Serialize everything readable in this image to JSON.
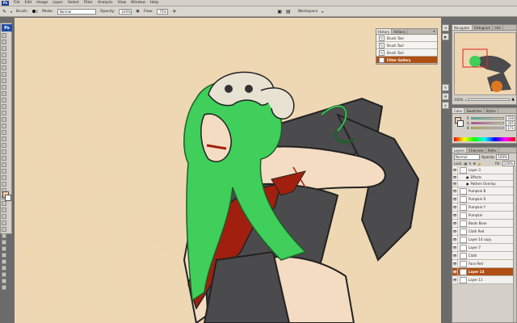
{
  "menu": {
    "app_icon": "Ps",
    "items": [
      "File",
      "Edit",
      "Image",
      "Layer",
      "Select",
      "Filter",
      "Analysis",
      "View",
      "Window",
      "Help"
    ]
  },
  "options": {
    "brush_label": "Brush:",
    "brush_size": "1",
    "mode_label": "Mode:",
    "mode_value": "Normal",
    "opacity_label": "Opacity:",
    "opacity_value": "100%",
    "flow_label": "Flow:",
    "flow_value": "75%",
    "workspace_label": "Workspace"
  },
  "toolbox": {
    "logo": "Ps"
  },
  "history": {
    "tabs": [
      "History",
      "Actions"
    ],
    "items": [
      {
        "label": "Brush Tool",
        "selected": false
      },
      {
        "label": "Brush Tool",
        "selected": false
      },
      {
        "label": "Brush Tool",
        "selected": false
      },
      {
        "label": "Filter Gallery",
        "selected": true
      }
    ]
  },
  "navigator": {
    "tabs": [
      "Navigator",
      "Histogram",
      "Info"
    ],
    "zoom": "100%"
  },
  "color": {
    "tabs": [
      "Color",
      "Swatches",
      "Styles"
    ],
    "r_label": "R",
    "g_label": "G",
    "b_label": "B",
    "r": "236",
    "g": "205",
    "b": "171",
    "fg": "#eccdab"
  },
  "layers": {
    "tabs": [
      "Layers",
      "Channels",
      "Paths"
    ],
    "blend": "Normal",
    "opacity_label": "Opacity:",
    "opacity": "100%",
    "lock_label": "Lock:",
    "fill_label": "Fill:",
    "fill": "100%",
    "items": [
      {
        "name": "Layer 3",
        "kind": "layer",
        "selected": false
      },
      {
        "name": "Effects",
        "kind": "fx",
        "selected": false
      },
      {
        "name": "Pattern Overlay",
        "kind": "fx",
        "selected": false
      },
      {
        "name": "Pumpkin B",
        "kind": "layer",
        "selected": false
      },
      {
        "name": "Pumpkin R",
        "kind": "layer",
        "selected": false
      },
      {
        "name": "Pumpkin Y",
        "kind": "layer",
        "selected": false
      },
      {
        "name": "Pumpkin",
        "kind": "layer",
        "selected": false
      },
      {
        "name": "Boots Base",
        "kind": "layer",
        "selected": false
      },
      {
        "name": "Cloth Red",
        "kind": "layer",
        "selected": false
      },
      {
        "name": "Layer 14 copy",
        "kind": "layer",
        "selected": false
      },
      {
        "name": "Layer 7",
        "kind": "layer",
        "selected": false
      },
      {
        "name": "Cloth",
        "kind": "layer",
        "selected": false
      },
      {
        "name": "Face Red",
        "kind": "layer",
        "selected": false
      },
      {
        "name": "Layer 14",
        "kind": "layer",
        "selected": true
      },
      {
        "name": "Layer 11",
        "kind": "layer",
        "selected": false
      }
    ]
  },
  "colors": {
    "canvas_bg": "#eed6b0",
    "hair": "#3fcf5a",
    "horn": "#e8e2d2",
    "skin": "#f4dcc2",
    "cloth_dark": "#4b4b4d",
    "cloth_red": "#a11f0e",
    "selection": "#b04f13"
  }
}
